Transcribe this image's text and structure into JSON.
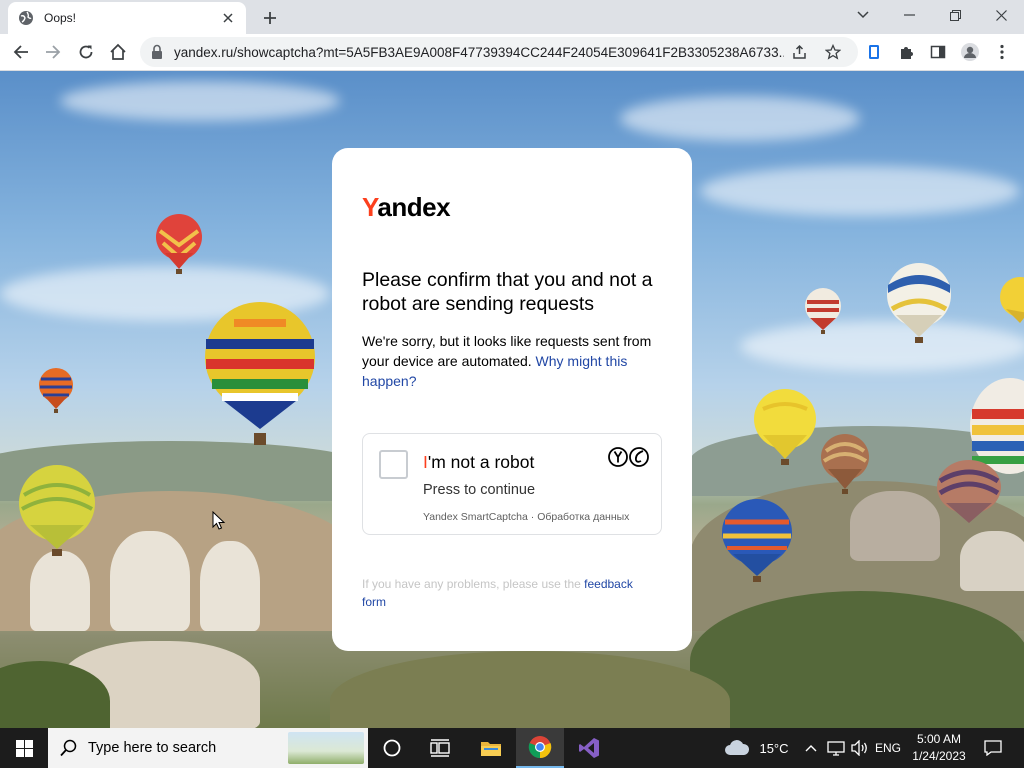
{
  "browser": {
    "tab_title": "Oops!",
    "url": "yandex.ru/showcaptcha?mt=5A5FB3AE9A008F47739394CC244F24054E309641F2B3305238A6733..."
  },
  "card": {
    "logo_y": "Y",
    "logo_rest": "andex",
    "heading": "Please confirm that you and not a robot are sending requests",
    "desc_text": "We're sorry, but it looks like requests sent from your device are automated.",
    "desc_link": "Why might this happen?",
    "captcha": {
      "title_i": "I",
      "title_rest": "'m not a robot",
      "subtitle": "Press to continue",
      "footer": "Yandex SmartCaptcha · Обработка данных"
    },
    "help_text": "If you have any problems, please use the",
    "help_link": "feedback form"
  },
  "taskbar": {
    "search_placeholder": "Type here to search",
    "weather": "15°C",
    "language": "ENG",
    "time": "5:00 AM",
    "date": "1/24/2023"
  },
  "colors": {
    "yandex_red": "#fc3f1d",
    "link_blue": "#2147a5"
  }
}
